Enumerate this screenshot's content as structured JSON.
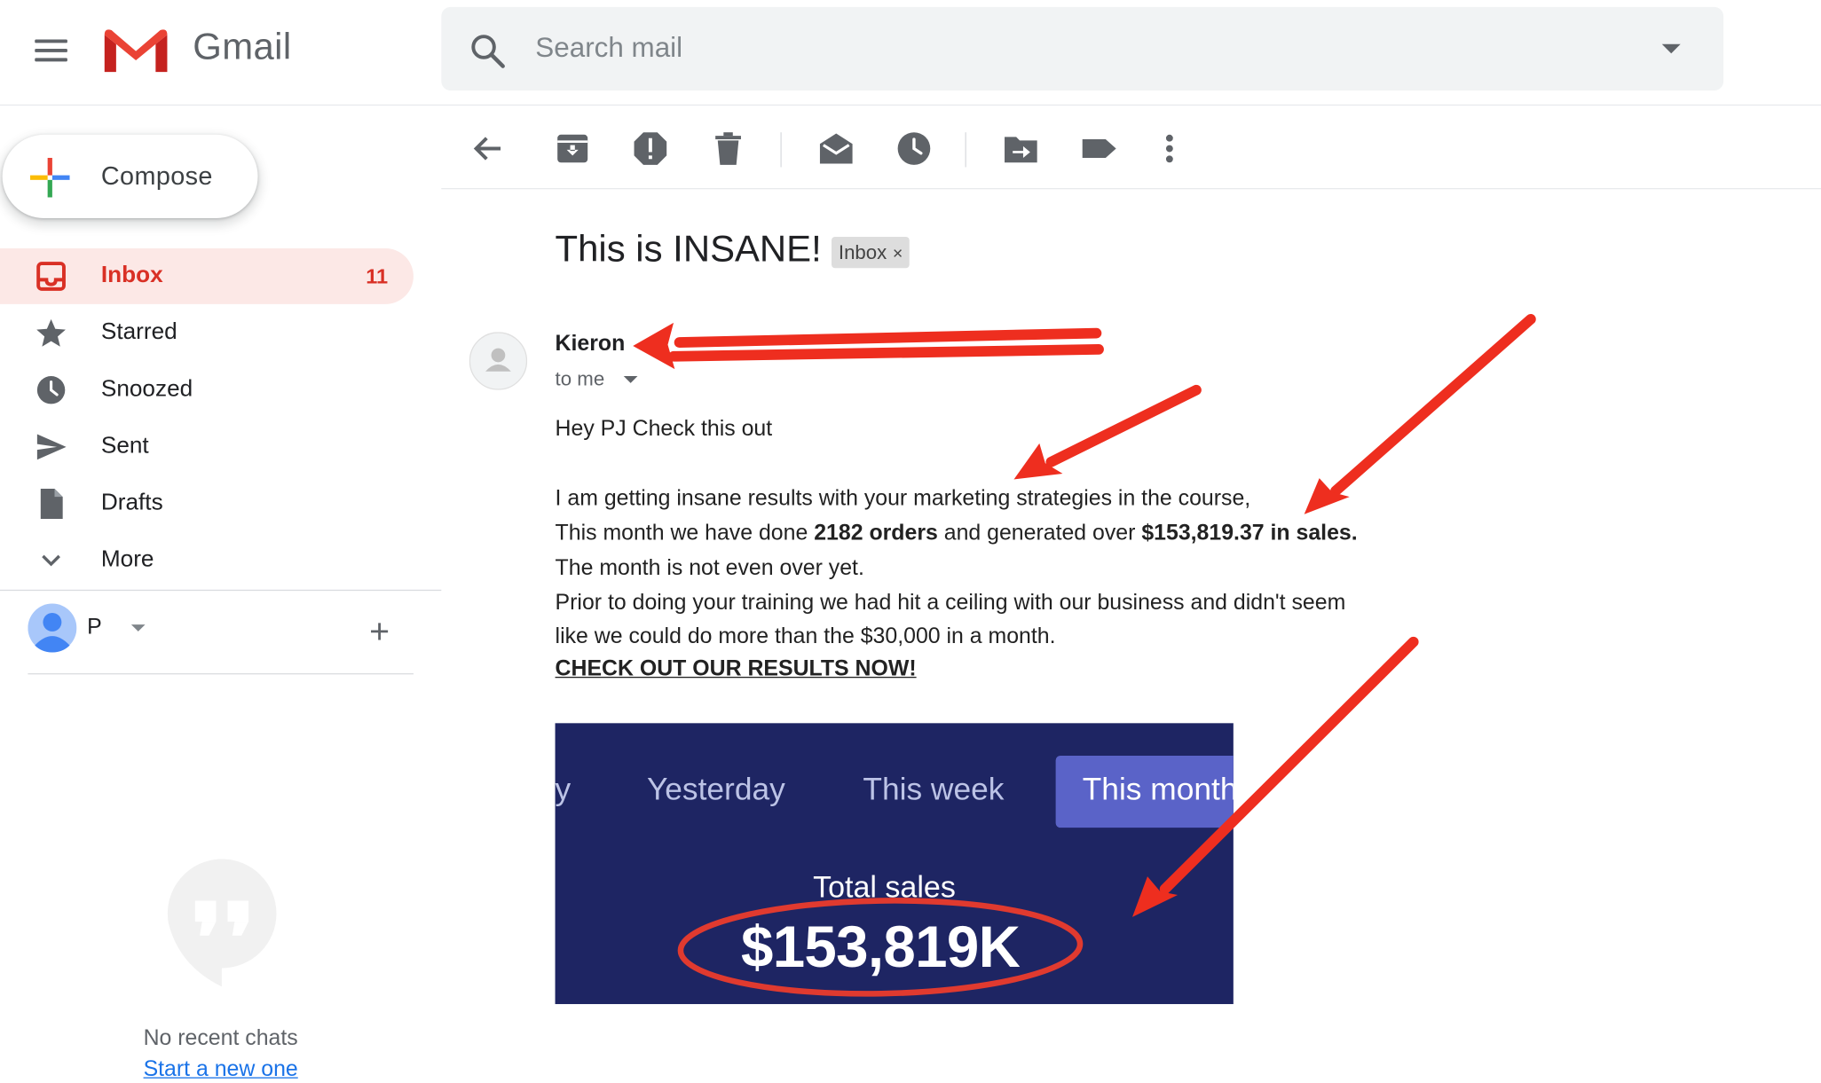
{
  "app": {
    "name": "Gmail"
  },
  "search": {
    "placeholder": "Search mail"
  },
  "sidebar": {
    "compose_label": "Compose",
    "items": [
      {
        "label": "Inbox",
        "count": "11",
        "icon": "inbox-icon"
      },
      {
        "label": "Starred",
        "icon": "star-icon"
      },
      {
        "label": "Snoozed",
        "icon": "clock-icon"
      },
      {
        "label": "Sent",
        "icon": "send-icon"
      },
      {
        "label": "Drafts",
        "icon": "draft-icon"
      },
      {
        "label": "More",
        "icon": "chevron-down-icon"
      }
    ],
    "hangouts": {
      "user": "P",
      "no_chats": "No recent chats",
      "start_new": "Start a new one"
    }
  },
  "toolbar": {
    "icons": [
      "back-arrow-icon",
      "archive-icon",
      "report-spam-icon",
      "delete-icon",
      "mark-unread-icon",
      "snooze-icon",
      "move-to-icon",
      "label-icon",
      "more-vert-icon"
    ]
  },
  "message": {
    "subject": "This is INSANE!",
    "label_chip": "Inbox",
    "label_chip_close": "×",
    "sender": "Kieron",
    "recipient": "to me",
    "body": {
      "greeting": "Hey PJ Check this out",
      "line1": "I am getting insane results with your marketing strategies in the course,",
      "line2_a": "This month we have done ",
      "line2_b": "2182 orders",
      "line2_c": " and generated over ",
      "line2_d": "$153,819.37 in sales.",
      "line3": "The month is not even over yet.",
      "line4": "Prior to doing your training we had hit a ceiling with our business and didn't seem",
      "line5": "like we could do more than the $30,000 in a month.",
      "cta": "CHECK OUT OUR RESULTS NOW!"
    },
    "embedded_image": {
      "tabs": [
        "y",
        "Yesterday",
        "This week",
        "This month"
      ],
      "active_tab": "This month",
      "label": "Total sales",
      "value": "$153,819K"
    }
  },
  "colors": {
    "accent_red": "#d93025",
    "inbox_highlight": "#fce8e6",
    "annotation_red": "#ee2e1f",
    "embed_background": "#1e2563",
    "embed_active_tab": "#5a63c8"
  }
}
